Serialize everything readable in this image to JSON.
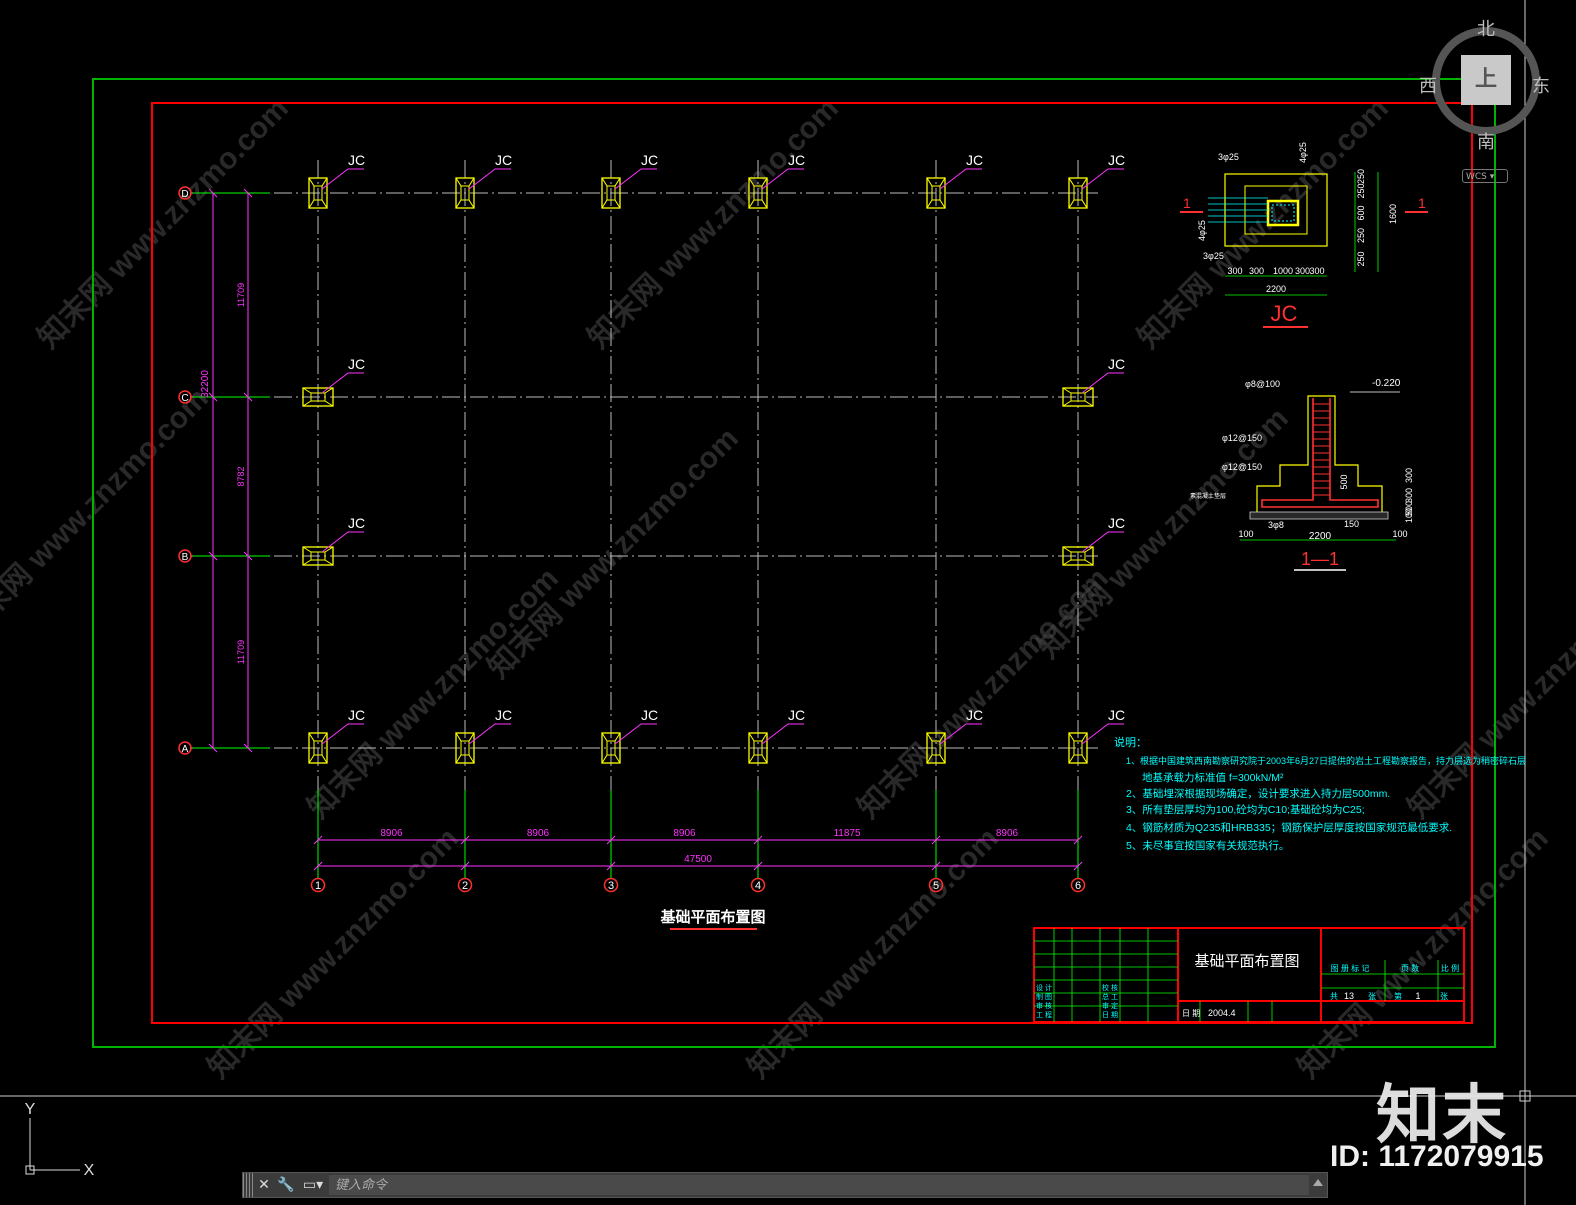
{
  "viewcube": {
    "north": "北",
    "south": "南",
    "east": "东",
    "west": "西",
    "top": "上",
    "wcs": "WCS"
  },
  "drawing": {
    "plan_title": "基础平面布置图",
    "footing_label": "JC",
    "axes_letters": [
      "A",
      "B",
      "C",
      "D"
    ],
    "axes_numbers": [
      "1",
      "2",
      "3",
      "4",
      "5",
      "6"
    ],
    "dims_vertical": [
      "11709",
      "8782",
      "11709"
    ],
    "dim_total_vertical": "32200",
    "dims_horizontal": [
      "8906",
      "8906",
      "8906",
      "11875",
      "8906"
    ],
    "dim_total_horizontal": "47500"
  },
  "detail_jc": {
    "title": "JC",
    "section_mark": "1",
    "rebar_labels": [
      "3φ25",
      "4φ25",
      "4φ25",
      "3φ25"
    ],
    "dims_right": [
      "250",
      "250",
      "600",
      "250",
      "250"
    ],
    "dim_right_total": "1600",
    "dims_bottom": [
      "300",
      "300",
      "1000",
      "300",
      "300"
    ],
    "dim_bottom_total": "2200"
  },
  "detail_section": {
    "title": "1—1",
    "elevation": "-0.220",
    "labels": [
      "φ8@100",
      "φ12@150",
      "φ12@150",
      "素混凝土垫层"
    ],
    "dims_right": [
      "300",
      "300",
      "500",
      "100"
    ],
    "dim_500": "500",
    "dims_bottom": [
      "100",
      "2200",
      "100"
    ],
    "bar_labels": [
      "3φ8",
      "150"
    ]
  },
  "notes": {
    "heading": "说明：",
    "lines": [
      "1、根据中国建筑西南勘察研究院于2003年6月27日提供的岩土工程勘察报告，持力层选为稍密碎石层",
      "地基承载力标准值 f=300kN/M²",
      "2、基础埋深根据现场确定，设计要求进入持力层500mm.",
      "3、所有垫层厚均为100,砼均为C10;基础砼均为C25;",
      "4、钢筋材质为Q235和HRB335；钢筋保护层厚度按国家规范最低要求.",
      "5、未尽事宜按国家有关规范执行。"
    ]
  },
  "title_block": {
    "drawing_name": "基础平面布置图",
    "date_label": "日 期",
    "date": "2004.4",
    "headers": [
      "图 册 标 记",
      "页 数",
      "比 例"
    ],
    "total_label": "共",
    "total_pages": "13",
    "page_unit": "张",
    "sheet_label": "第",
    "sheet_no": "1",
    "roles": [
      "设 计",
      "制 图",
      "审 核",
      "工 程"
    ],
    "roles2": [
      "校 核",
      "总 工",
      "审 定",
      "日 期"
    ]
  },
  "ucs": {
    "x": "X",
    "y": "Y"
  },
  "command_line": {
    "placeholder": "键入命令"
  },
  "watermark": {
    "logo": "知末",
    "id": "ID: 1172079915",
    "site": "知末网 www.znzmo.com"
  },
  "colors": {
    "bg": "#000000",
    "frame_outer": "#00b300",
    "frame_inner": "#ff0000",
    "footing": "#ffff00",
    "axis": "#00ff00",
    "dims": "#ff33ff",
    "notes": "#00ffff",
    "text": "#ffffff"
  }
}
